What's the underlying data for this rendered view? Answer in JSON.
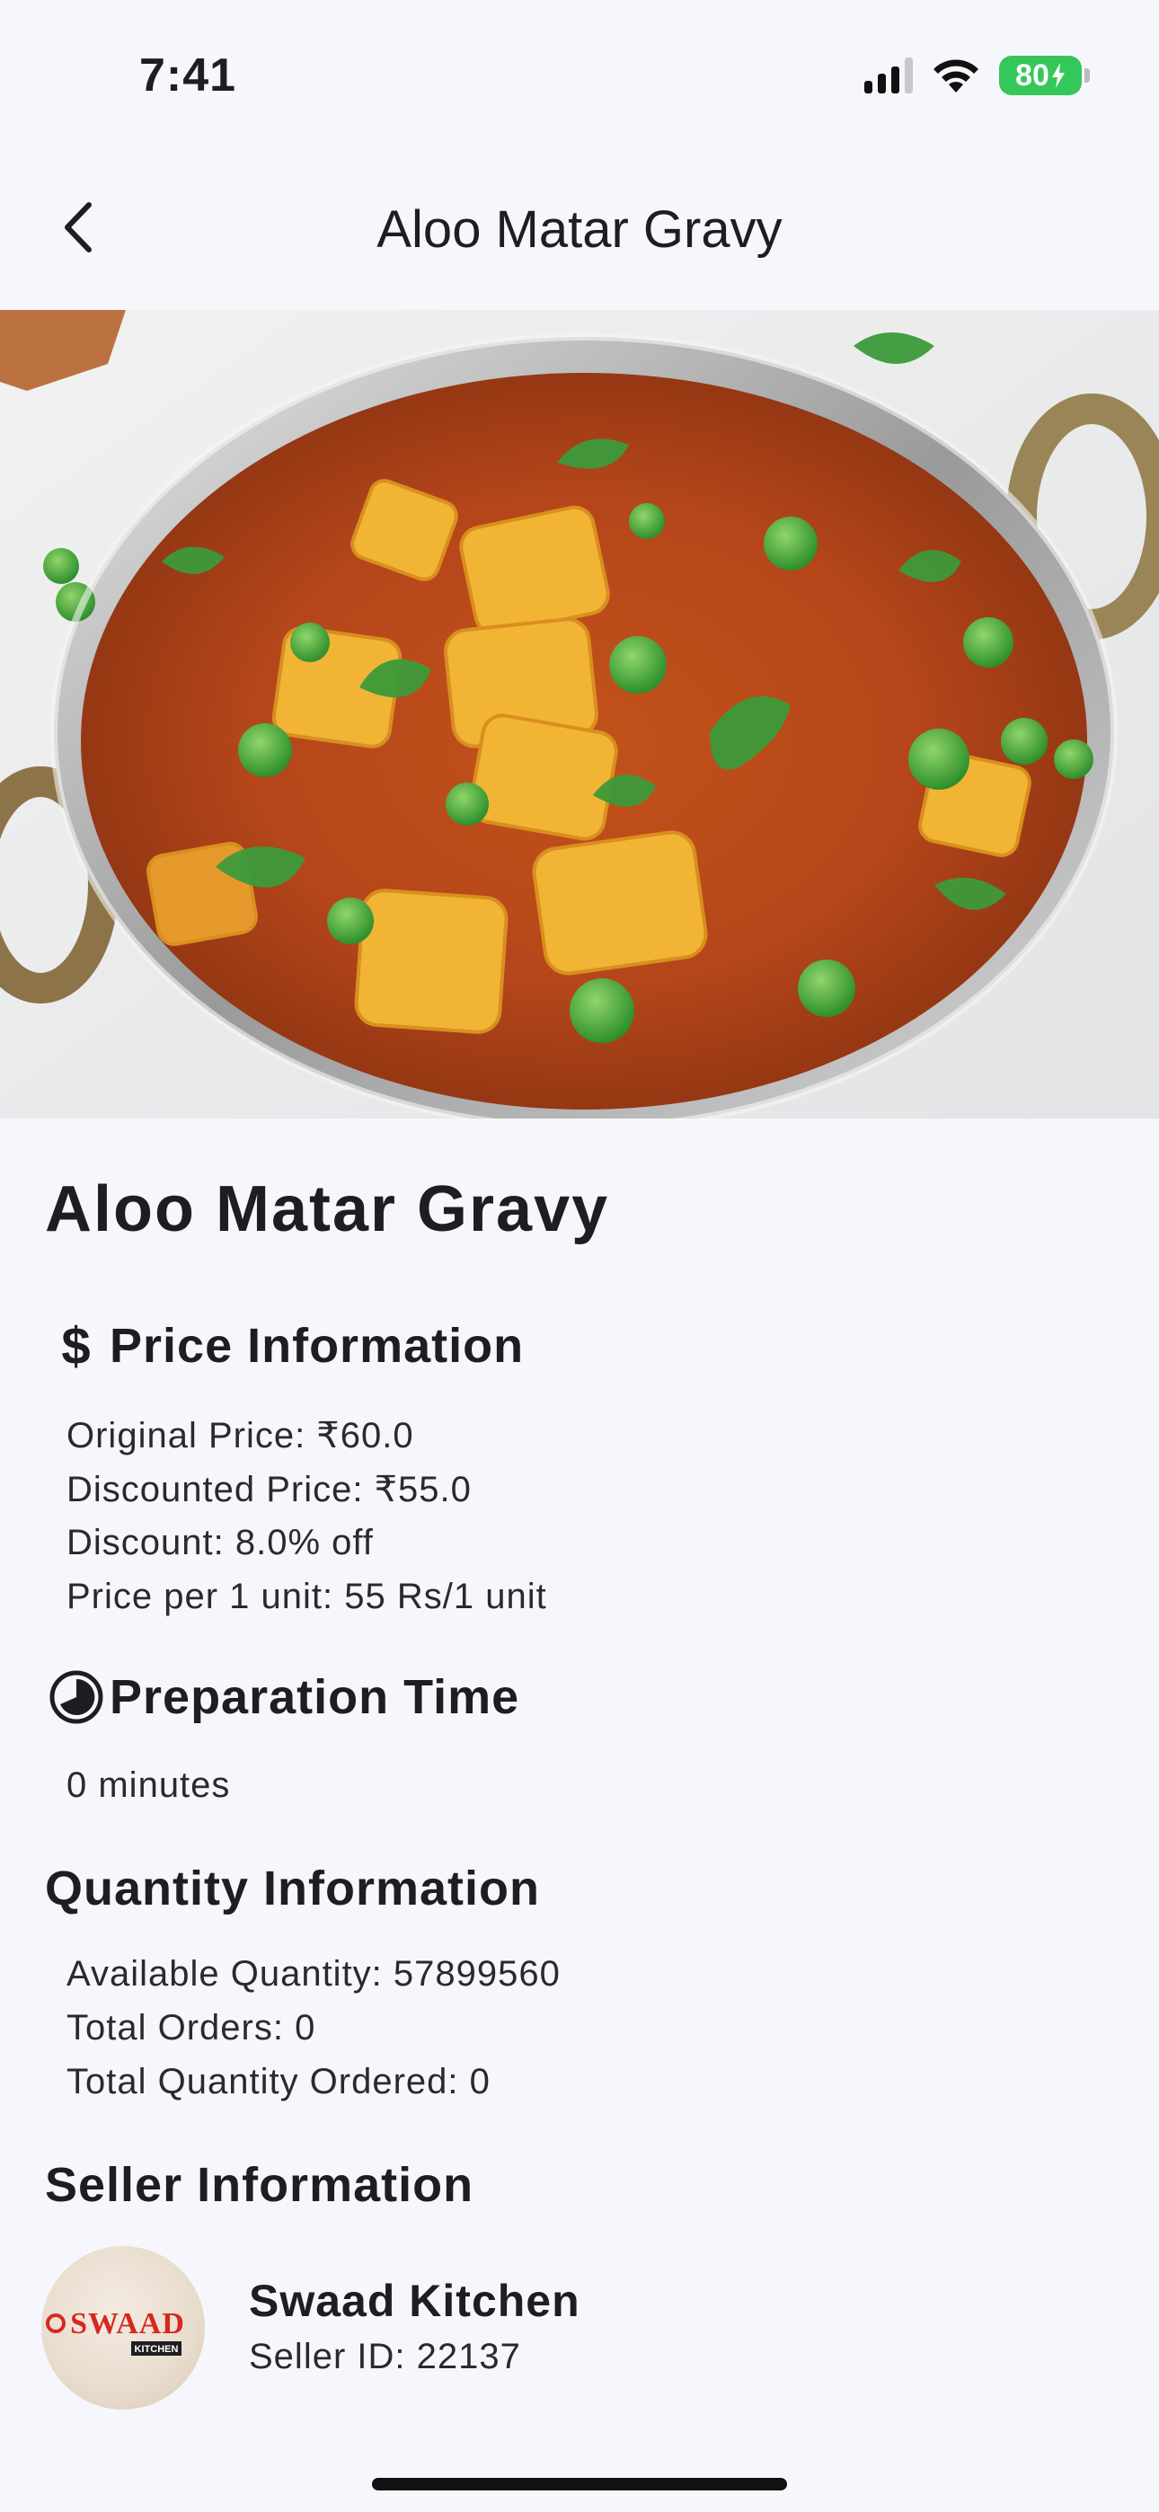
{
  "status_bar": {
    "time": "7:41",
    "battery": "80",
    "icons": [
      "cellular-signal-icon",
      "wifi-icon",
      "battery-charging-icon"
    ]
  },
  "nav": {
    "title": "Aloo Matar Gravy",
    "back_icon": "chevron-left-icon"
  },
  "hero": {
    "description_icon": "dish-photo"
  },
  "dish": {
    "title": "Aloo Matar Gravy"
  },
  "price_info": {
    "heading": "Price Information",
    "icon": "dollar-icon",
    "lines": [
      "Original Price: ₹60.0",
      "Discounted Price: ₹55.0",
      "Discount: 8.0% off",
      "Price per 1 unit: 55 Rs/1 unit"
    ]
  },
  "prep_time": {
    "heading": "Preparation Time",
    "icon": "timer-icon",
    "value": "0 minutes"
  },
  "quantity_info": {
    "heading": "Quantity Information",
    "lines": [
      "Available Quantity: 57899560",
      "Total Orders: 0",
      "Total Quantity Ordered: 0"
    ]
  },
  "seller": {
    "heading": "Seller Information",
    "name": "Swaad Kitchen",
    "id_line": "Seller ID: 22137",
    "logo_text": "SWAAD",
    "logo_subtext": "KITCHEN"
  },
  "colors": {
    "background": "#f6f7fc",
    "text": "#1e1e22",
    "battery": "#34c759",
    "logo_red": "#d6281f"
  }
}
